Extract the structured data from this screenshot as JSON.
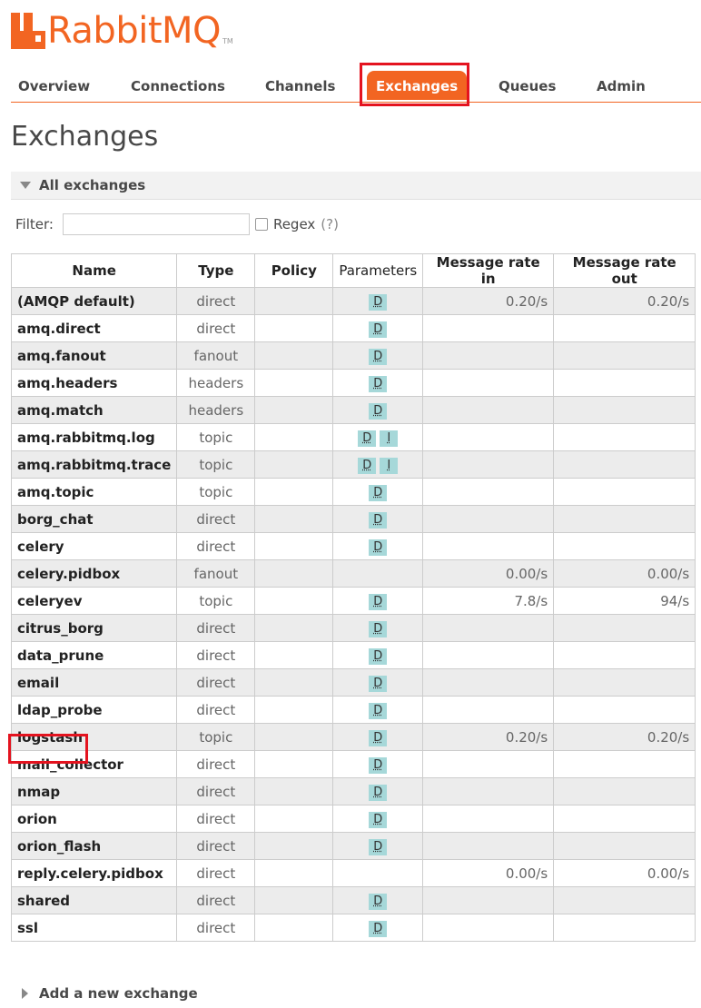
{
  "logo": {
    "text": "RabbitMQ",
    "tm": "TM",
    "color": "#f26522"
  },
  "tabs": [
    {
      "label": "Overview",
      "active": false
    },
    {
      "label": "Connections",
      "active": false
    },
    {
      "label": "Channels",
      "active": false
    },
    {
      "label": "Exchanges",
      "active": true
    },
    {
      "label": "Queues",
      "active": false
    },
    {
      "label": "Admin",
      "active": false
    }
  ],
  "page_title": "Exchanges",
  "section": {
    "label": "All exchanges"
  },
  "filter": {
    "label": "Filter:",
    "value": "",
    "regex_label": "Regex",
    "regex_help": "(?)"
  },
  "table": {
    "headers": [
      "Name",
      "Type",
      "Policy",
      "Parameters",
      "Message rate in",
      "Message rate out"
    ],
    "rows": [
      {
        "name": "(AMQP default)",
        "type": "direct",
        "policy": "",
        "params": [
          "D"
        ],
        "rate_in": "0.20/s",
        "rate_out": "0.20/s"
      },
      {
        "name": "amq.direct",
        "type": "direct",
        "policy": "",
        "params": [
          "D"
        ],
        "rate_in": "",
        "rate_out": ""
      },
      {
        "name": "amq.fanout",
        "type": "fanout",
        "policy": "",
        "params": [
          "D"
        ],
        "rate_in": "",
        "rate_out": ""
      },
      {
        "name": "amq.headers",
        "type": "headers",
        "policy": "",
        "params": [
          "D"
        ],
        "rate_in": "",
        "rate_out": ""
      },
      {
        "name": "amq.match",
        "type": "headers",
        "policy": "",
        "params": [
          "D"
        ],
        "rate_in": "",
        "rate_out": ""
      },
      {
        "name": "amq.rabbitmq.log",
        "type": "topic",
        "policy": "",
        "params": [
          "D",
          "I"
        ],
        "rate_in": "",
        "rate_out": ""
      },
      {
        "name": "amq.rabbitmq.trace",
        "type": "topic",
        "policy": "",
        "params": [
          "D",
          "I"
        ],
        "rate_in": "",
        "rate_out": ""
      },
      {
        "name": "amq.topic",
        "type": "topic",
        "policy": "",
        "params": [
          "D"
        ],
        "rate_in": "",
        "rate_out": ""
      },
      {
        "name": "borg_chat",
        "type": "direct",
        "policy": "",
        "params": [
          "D"
        ],
        "rate_in": "",
        "rate_out": ""
      },
      {
        "name": "celery",
        "type": "direct",
        "policy": "",
        "params": [
          "D"
        ],
        "rate_in": "",
        "rate_out": ""
      },
      {
        "name": "celery.pidbox",
        "type": "fanout",
        "policy": "",
        "params": [],
        "rate_in": "0.00/s",
        "rate_out": "0.00/s"
      },
      {
        "name": "celeryev",
        "type": "topic",
        "policy": "",
        "params": [
          "D"
        ],
        "rate_in": "7.8/s",
        "rate_out": "94/s"
      },
      {
        "name": "citrus_borg",
        "type": "direct",
        "policy": "",
        "params": [
          "D"
        ],
        "rate_in": "",
        "rate_out": ""
      },
      {
        "name": "data_prune",
        "type": "direct",
        "policy": "",
        "params": [
          "D"
        ],
        "rate_in": "",
        "rate_out": ""
      },
      {
        "name": "email",
        "type": "direct",
        "policy": "",
        "params": [
          "D"
        ],
        "rate_in": "",
        "rate_out": ""
      },
      {
        "name": "ldap_probe",
        "type": "direct",
        "policy": "",
        "params": [
          "D"
        ],
        "rate_in": "",
        "rate_out": ""
      },
      {
        "name": "logstash",
        "type": "topic",
        "policy": "",
        "params": [
          "D"
        ],
        "rate_in": "0.20/s",
        "rate_out": "0.20/s"
      },
      {
        "name": "mail_collector",
        "type": "direct",
        "policy": "",
        "params": [
          "D"
        ],
        "rate_in": "",
        "rate_out": ""
      },
      {
        "name": "nmap",
        "type": "direct",
        "policy": "",
        "params": [
          "D"
        ],
        "rate_in": "",
        "rate_out": ""
      },
      {
        "name": "orion",
        "type": "direct",
        "policy": "",
        "params": [
          "D"
        ],
        "rate_in": "",
        "rate_out": ""
      },
      {
        "name": "orion_flash",
        "type": "direct",
        "policy": "",
        "params": [
          "D"
        ],
        "rate_in": "",
        "rate_out": ""
      },
      {
        "name": "reply.celery.pidbox",
        "type": "direct",
        "policy": "",
        "params": [],
        "rate_in": "0.00/s",
        "rate_out": "0.00/s"
      },
      {
        "name": "shared",
        "type": "direct",
        "policy": "",
        "params": [
          "D"
        ],
        "rate_in": "",
        "rate_out": ""
      },
      {
        "name": "ssl",
        "type": "direct",
        "policy": "",
        "params": [
          "D"
        ],
        "rate_in": "",
        "rate_out": ""
      }
    ]
  },
  "add_section": {
    "label": "Add a new exchange"
  }
}
